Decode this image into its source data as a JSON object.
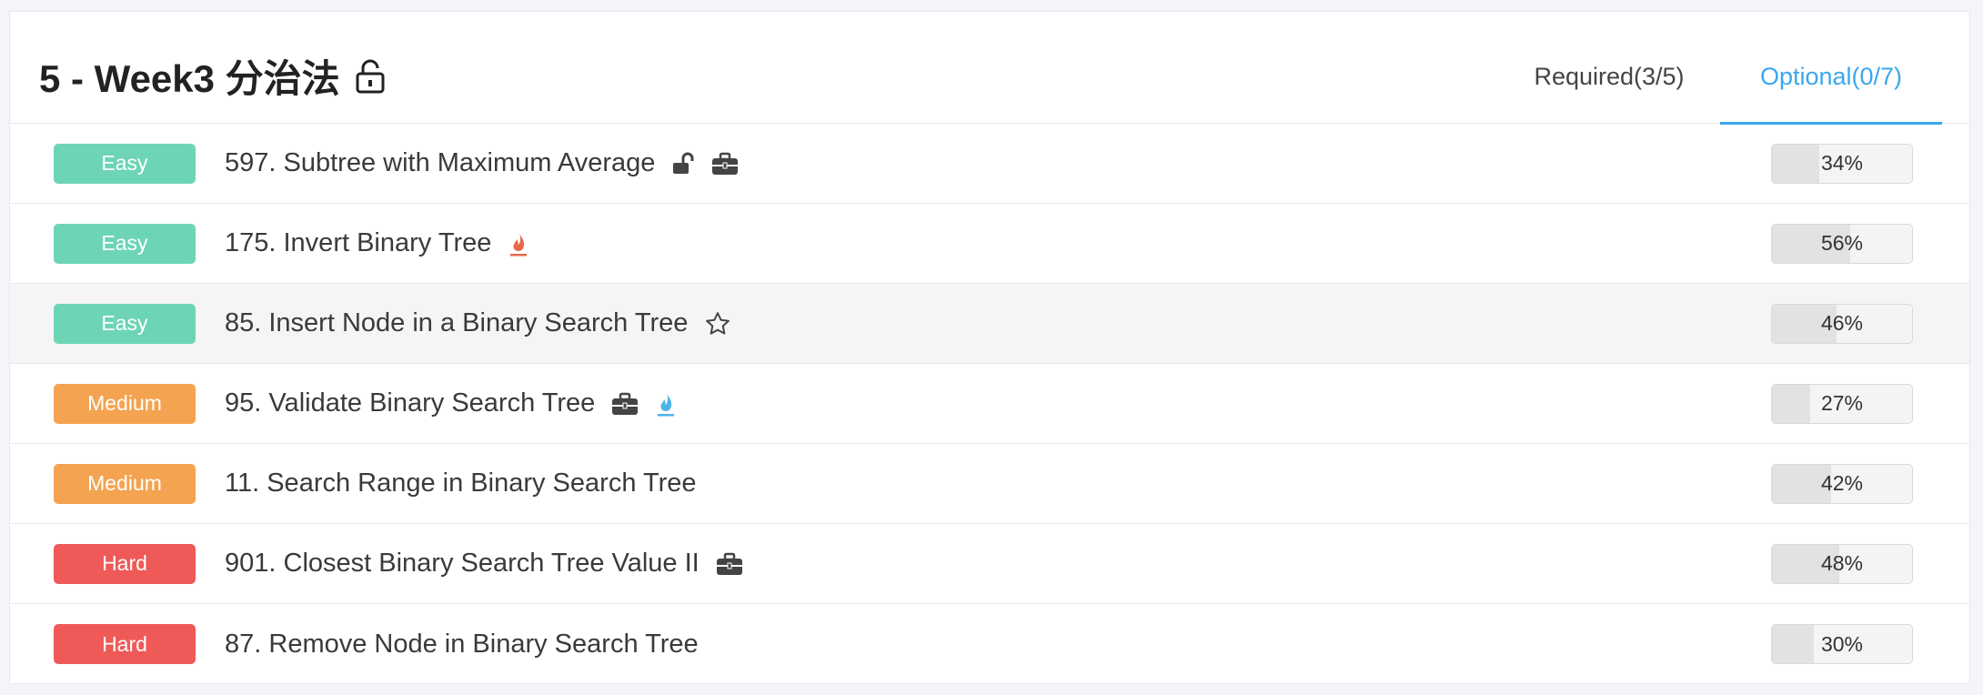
{
  "header": {
    "title": "5 - Week3 分治法",
    "lock_icon": "unlock-icon",
    "tabs": [
      {
        "label": "Required(3/5)",
        "active": false
      },
      {
        "label": "Optional(0/7)",
        "active": true
      }
    ]
  },
  "colors": {
    "easy": "#6dd5b5",
    "medium": "#f4a350",
    "hard": "#ef5a59",
    "accent": "#3aa7ee",
    "fire_red": "#e8684a",
    "fire_blue": "#4db3e8"
  },
  "problems": [
    {
      "difficulty": "Easy",
      "level": "easy",
      "title": "597. Subtree with Maximum Average",
      "icons": [
        "unlock-icon",
        "briefcase-icon"
      ],
      "pass_rate": "34%",
      "pass_fraction": 0.34
    },
    {
      "difficulty": "Easy",
      "level": "easy",
      "title": "175. Invert Binary Tree",
      "icons": [
        "fire-red-icon"
      ],
      "pass_rate": "56%",
      "pass_fraction": 0.56
    },
    {
      "difficulty": "Easy",
      "level": "easy",
      "title": "85. Insert Node in a Binary Search Tree",
      "icons": [
        "star-icon"
      ],
      "pass_rate": "46%",
      "pass_fraction": 0.46
    },
    {
      "difficulty": "Medium",
      "level": "medium",
      "title": "95. Validate Binary Search Tree",
      "icons": [
        "briefcase-icon",
        "fire-blue-icon"
      ],
      "pass_rate": "27%",
      "pass_fraction": 0.27
    },
    {
      "difficulty": "Medium",
      "level": "medium",
      "title": "11. Search Range in Binary Search Tree",
      "icons": [],
      "pass_rate": "42%",
      "pass_fraction": 0.42
    },
    {
      "difficulty": "Hard",
      "level": "hard",
      "title": "901. Closest Binary Search Tree Value II",
      "icons": [
        "briefcase-icon"
      ],
      "pass_rate": "48%",
      "pass_fraction": 0.48
    },
    {
      "difficulty": "Hard",
      "level": "hard",
      "title": "87. Remove Node in Binary Search Tree",
      "icons": [],
      "pass_rate": "30%",
      "pass_fraction": 0.3
    }
  ]
}
